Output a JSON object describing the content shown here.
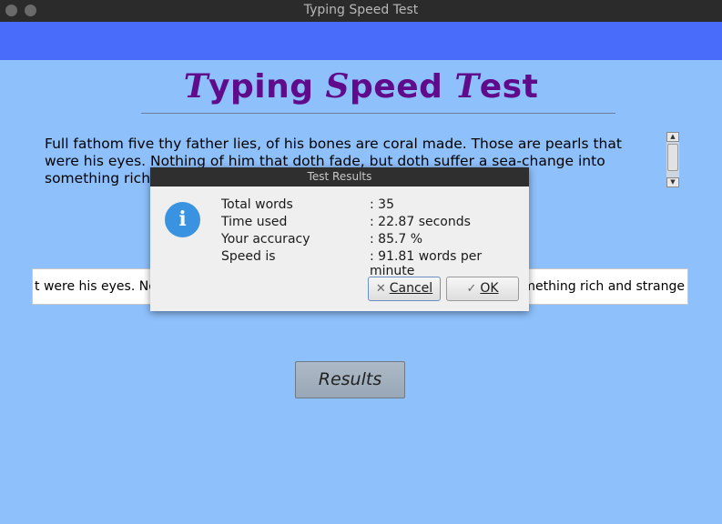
{
  "window": {
    "title": "Typing Speed Test"
  },
  "heading": {
    "parts": [
      "T",
      "yping ",
      "S",
      "peed ",
      "T",
      "est"
    ]
  },
  "passage": {
    "text": "Full fathom five thy father lies, of his bones are coral made. Those are pearls that were his eyes. Nothing of him that doth fade, but doth suffer a sea-change into something rich and strange"
  },
  "typing_field": {
    "visible_left": "t were his eyes. Not",
    "visible_right": "omething rich and strange"
  },
  "results_button": {
    "label": "Results"
  },
  "dialog": {
    "title": "Test Results",
    "icon": "info-icon",
    "stats": [
      {
        "label": "Total words",
        "value": ": 35"
      },
      {
        "label": "Time used",
        "value": ": 22.87 seconds"
      },
      {
        "label": "Your accuracy",
        "value": ": 85.7 %"
      },
      {
        "label": "Speed is",
        "value": ": 91.81 words per minute"
      }
    ],
    "cancel_label": "Cancel",
    "ok_label": "OK"
  },
  "colors": {
    "background": "#8ec0fc",
    "bluebar": "#4a6cfb",
    "heading": "#600b8c",
    "info_icon": "#3a93e0"
  }
}
